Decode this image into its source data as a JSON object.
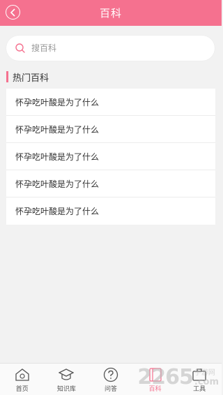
{
  "header": {
    "title": "百科"
  },
  "search": {
    "placeholder": "搜百科"
  },
  "section": {
    "title": "热门百科"
  },
  "list": {
    "items": [
      {
        "text": "怀孕吃叶酸是为了什么"
      },
      {
        "text": "怀孕吃叶酸是为了什么"
      },
      {
        "text": "怀孕吃叶酸是为了什么"
      },
      {
        "text": "怀孕吃叶酸是为了什么"
      },
      {
        "text": "怀孕吃叶酸是为了什么"
      }
    ]
  },
  "tabbar": {
    "tabs": [
      {
        "label": "首页",
        "icon": "home-icon"
      },
      {
        "label": "知识库",
        "icon": "graduation-cap-icon"
      },
      {
        "label": "问答",
        "icon": "question-icon"
      },
      {
        "label": "百科",
        "icon": "book-icon",
        "active": true
      },
      {
        "label": "工具",
        "icon": "tools-icon"
      }
    ]
  },
  "watermark": {
    "number": "2265",
    "cn": "手游网",
    "suffix": ".com"
  },
  "colors": {
    "accent": "#f5718f",
    "background": "#f2f2f2"
  }
}
